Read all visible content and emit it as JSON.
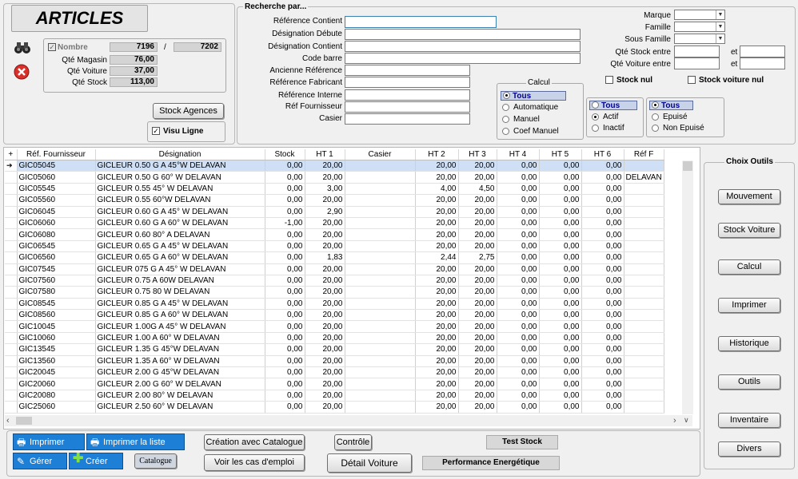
{
  "app": {
    "title": "ARTICLES"
  },
  "counts": {
    "nombre_label": "Nombre",
    "nombre_checked": true,
    "nombre": "7196",
    "sep": "/",
    "total": "7202",
    "rows": [
      {
        "label": "Qté Magasin",
        "value": "76,00"
      },
      {
        "label": "Qté Voiture",
        "value": "37,00"
      },
      {
        "label": "Qté Stock",
        "value": "113,00"
      }
    ],
    "stock_agences": "Stock Agences",
    "visu_ligne": "Visu Ligne",
    "visu_ligne_checked": true
  },
  "search": {
    "title": "Recherche par...",
    "fields": [
      "Référence Contient",
      "Désignation Débute",
      "Désignation Contient",
      "Code barre",
      "Ancienne Référence",
      "Référence Fabricant",
      "Référence Interne",
      "Réf Fournisseur",
      "Casier"
    ],
    "right_fields": [
      "Marque",
      "Famille",
      "Sous Famille",
      "Qté Stock entre",
      "Qté Voiture entre"
    ],
    "et": "et",
    "stock_nul": "Stock nul",
    "stock_voiture_nul": "Stock voiture nul",
    "calcul": {
      "title": "Calcul",
      "options": [
        "Tous",
        "Automatique",
        "Manuel",
        "Coef Manuel"
      ],
      "selected": 0
    },
    "etat": {
      "options": [
        "Tous",
        "Actif",
        "Inactif"
      ],
      "highlight": 0,
      "checked": 1
    },
    "epuise": {
      "options": [
        "Tous",
        "Epuisé",
        "Non Epuisé"
      ],
      "highlight": 0,
      "checked": 0
    }
  },
  "table": {
    "headers": [
      "+",
      "Réf. Fournisseur",
      "Désignation",
      "Stock",
      "HT 1",
      "Casier",
      "HT 2",
      "HT 3",
      "HT 4",
      "HT 5",
      "HT 6",
      "Réf F"
    ],
    "rows": [
      [
        "GIC05045",
        "GICLEUR 0.50 G A 45°W  DELAVAN",
        "0,00",
        "20,00",
        "",
        "20,00",
        "20,00",
        "0,00",
        "0,00",
        "0,00",
        ""
      ],
      [
        "GIC05060",
        "GICLEUR 0.50 G 60° W DELAVAN",
        "0,00",
        "20,00",
        "",
        "20,00",
        "20,00",
        "0,00",
        "0,00",
        "0,00",
        "DELAVAN"
      ],
      [
        "GIC05545",
        "GICLEUR 0.55 45° W DELAVAN",
        "0,00",
        "3,00",
        "",
        "4,00",
        "4,50",
        "0,00",
        "0,00",
        "0,00",
        ""
      ],
      [
        "GIC05560",
        "GICLEUR 0.55 60°W DELAVAN",
        "0,00",
        "20,00",
        "",
        "20,00",
        "20,00",
        "0,00",
        "0,00",
        "0,00",
        ""
      ],
      [
        "GIC06045",
        "GICLEUR 0.60 G A 45° W DELAVAN",
        "0,00",
        "2,90",
        "",
        "20,00",
        "20,00",
        "0,00",
        "0,00",
        "0,00",
        ""
      ],
      [
        "GIC06060",
        "GICLEUR  0.60 G A 60° W DELAVAN",
        "-1,00",
        "20,00",
        "",
        "20,00",
        "20,00",
        "0,00",
        "0,00",
        "0,00",
        ""
      ],
      [
        "GIC06080",
        "GICLEUR 0.60 80° A DELAVAN",
        "0,00",
        "20,00",
        "",
        "20,00",
        "20,00",
        "0,00",
        "0,00",
        "0,00",
        ""
      ],
      [
        "GIC06545",
        "GICLEUR 0.65 G A 45° W DELAVAN",
        "0,00",
        "20,00",
        "",
        "20,00",
        "20,00",
        "0,00",
        "0,00",
        "0,00",
        ""
      ],
      [
        "GIC06560",
        "GICLEUR 0.65 G A 60° W DELAVAN",
        "0,00",
        "1,83",
        "",
        "2,44",
        "2,75",
        "0,00",
        "0,00",
        "0,00",
        ""
      ],
      [
        "GIC07545",
        "GICLEUR 075 G A 45° W DELAVAN",
        "0,00",
        "20,00",
        "",
        "20,00",
        "20,00",
        "0,00",
        "0,00",
        "0,00",
        ""
      ],
      [
        "GIC07560",
        "GICLEUR 0.75 A 60W DELAVAN",
        "0,00",
        "20,00",
        "",
        "20,00",
        "20,00",
        "0,00",
        "0,00",
        "0,00",
        ""
      ],
      [
        "GIC07580",
        "GICLEUR 0.75 80 W DELAVAN",
        "0,00",
        "20,00",
        "",
        "20,00",
        "20,00",
        "0,00",
        "0,00",
        "0,00",
        ""
      ],
      [
        "GIC08545",
        "GICLEUR 0.85 G A 45° W DELAVAN",
        "0,00",
        "20,00",
        "",
        "20,00",
        "20,00",
        "0,00",
        "0,00",
        "0,00",
        ""
      ],
      [
        "GIC08560",
        "GICLEUR 0.85 G A 60° W DELAVAN",
        "0,00",
        "20,00",
        "",
        "20,00",
        "20,00",
        "0,00",
        "0,00",
        "0,00",
        ""
      ],
      [
        "GIC10045",
        "GICLEUR 1.00G A 45° W DELAVAN",
        "0,00",
        "20,00",
        "",
        "20,00",
        "20,00",
        "0,00",
        "0,00",
        "0,00",
        ""
      ],
      [
        "GIC10060",
        "GICLEUR 1.00 A 60° W DELAVAN",
        "0,00",
        "20,00",
        "",
        "20,00",
        "20,00",
        "0,00",
        "0,00",
        "0,00",
        ""
      ],
      [
        "GIC13545",
        "GICLEUR 1.35 G 45°W  DELAVAN",
        "0,00",
        "20,00",
        "",
        "20,00",
        "20,00",
        "0,00",
        "0,00",
        "0,00",
        ""
      ],
      [
        "GIC13560",
        "GICLEUR 1.35 A 60° W DELAVAN",
        "0,00",
        "20,00",
        "",
        "20,00",
        "20,00",
        "0,00",
        "0,00",
        "0,00",
        ""
      ],
      [
        "GIC20045",
        "GICLEUR 2.00 G 45°W DELAVAN",
        "0,00",
        "20,00",
        "",
        "20,00",
        "20,00",
        "0,00",
        "0,00",
        "0,00",
        ""
      ],
      [
        "GIC20060",
        "GICLEUR 2.00 G 60° W DELAVAN",
        "0,00",
        "20,00",
        "",
        "20,00",
        "20,00",
        "0,00",
        "0,00",
        "0,00",
        ""
      ],
      [
        "GIC20080",
        "GICLEUR 2.00 80° W DELAVAN",
        "0,00",
        "20,00",
        "",
        "20,00",
        "20,00",
        "0,00",
        "0,00",
        "0,00",
        ""
      ],
      [
        "GIC25060",
        "GICLEUR 2.50 60° W DELAVAN",
        "0,00",
        "20,00",
        "",
        "20,00",
        "20,00",
        "0,00",
        "0,00",
        "0,00",
        ""
      ]
    ],
    "selected_row": 0
  },
  "tools": {
    "title": "Choix Outils",
    "buttons": [
      "Mouvement",
      "Stock Voiture",
      "Calcul",
      "Imprimer",
      "Historique",
      "Outils",
      "Inventaire",
      "Divers"
    ]
  },
  "bottom": {
    "imprimer": "Imprimer",
    "imprimer_liste": "Imprimer la liste",
    "gerer": "Gérer",
    "creer": "Créer",
    "catalogue": "Catalogue",
    "creation_catalogue": "Création avec Catalogue",
    "voir_cas": "Voir les cas d'emploi",
    "controle": "Contrôle",
    "detail_voiture": "Détail Voiture",
    "test_stock": "Test Stock",
    "performance": "Performance Energétique"
  },
  "colors": {
    "accent_blue": "#1e7fd6",
    "selected_row": "#cfe0f6",
    "close_red": "#d9302a"
  }
}
